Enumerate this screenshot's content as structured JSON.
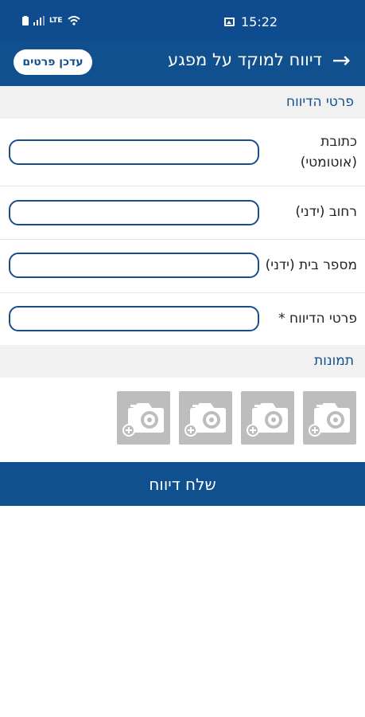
{
  "status_bar": {
    "time": "15:22",
    "network": "LTE"
  },
  "header": {
    "title": "דיווח למוקד על מפגע",
    "update_button": "עדכן פרטים",
    "colors": {
      "primary": "#11508f",
      "status": "#0f4c8f"
    }
  },
  "report_section": {
    "title": "פרטי הדיווח",
    "fields": [
      {
        "label_line1": "כתובת",
        "label_line2": "(אוטומטי)",
        "value": ""
      },
      {
        "label": "רחוב (ידני)",
        "value": ""
      },
      {
        "label": "מספר בית (ידני)",
        "value": ""
      },
      {
        "label": "פרטי הדיווח *",
        "value": ""
      }
    ]
  },
  "photos_section": {
    "title": "תמונות",
    "slots": [
      "add-photo-icon",
      "add-photo-icon",
      "add-photo-icon",
      "add-photo-icon"
    ]
  },
  "submit": {
    "label": "שלח דיווח"
  }
}
